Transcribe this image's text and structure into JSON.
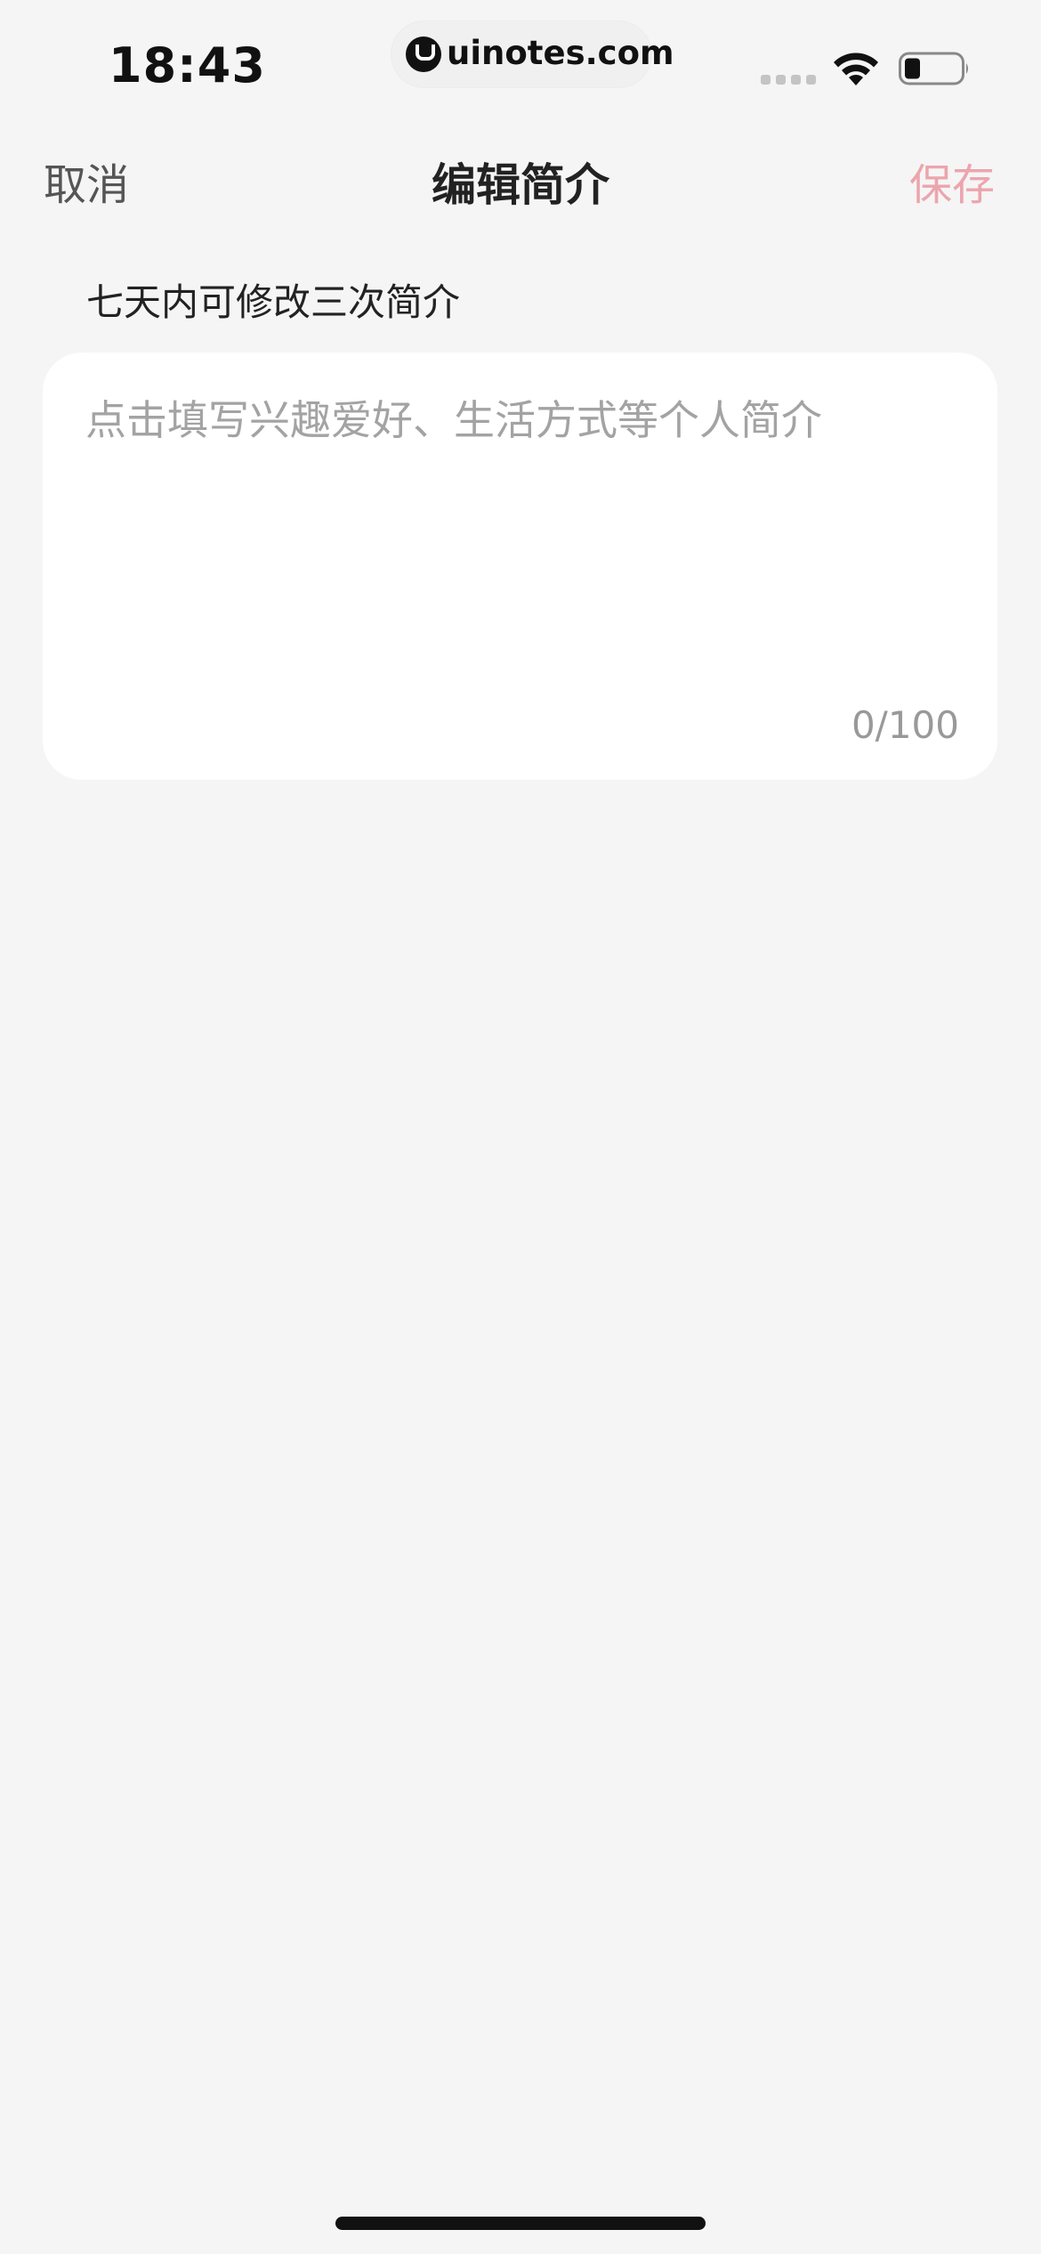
{
  "status_bar": {
    "time": "18:43",
    "url": "uinotes.com",
    "wifi_icon": "wifi-icon",
    "battery_icon": "battery-icon",
    "signal_icon": "cellular-signal-icon"
  },
  "nav": {
    "cancel_label": "取消",
    "title": "编辑简介",
    "save_label": "保存"
  },
  "hint": "七天内可修改三次简介",
  "bio": {
    "value": "",
    "placeholder": "点击填写兴趣爱好、生活方式等个人简介",
    "counter": "0/100"
  },
  "colors": {
    "background": "#f5f5f5",
    "card": "#ffffff",
    "save_accent": "#eca5ad",
    "placeholder": "#a3a3a3"
  }
}
